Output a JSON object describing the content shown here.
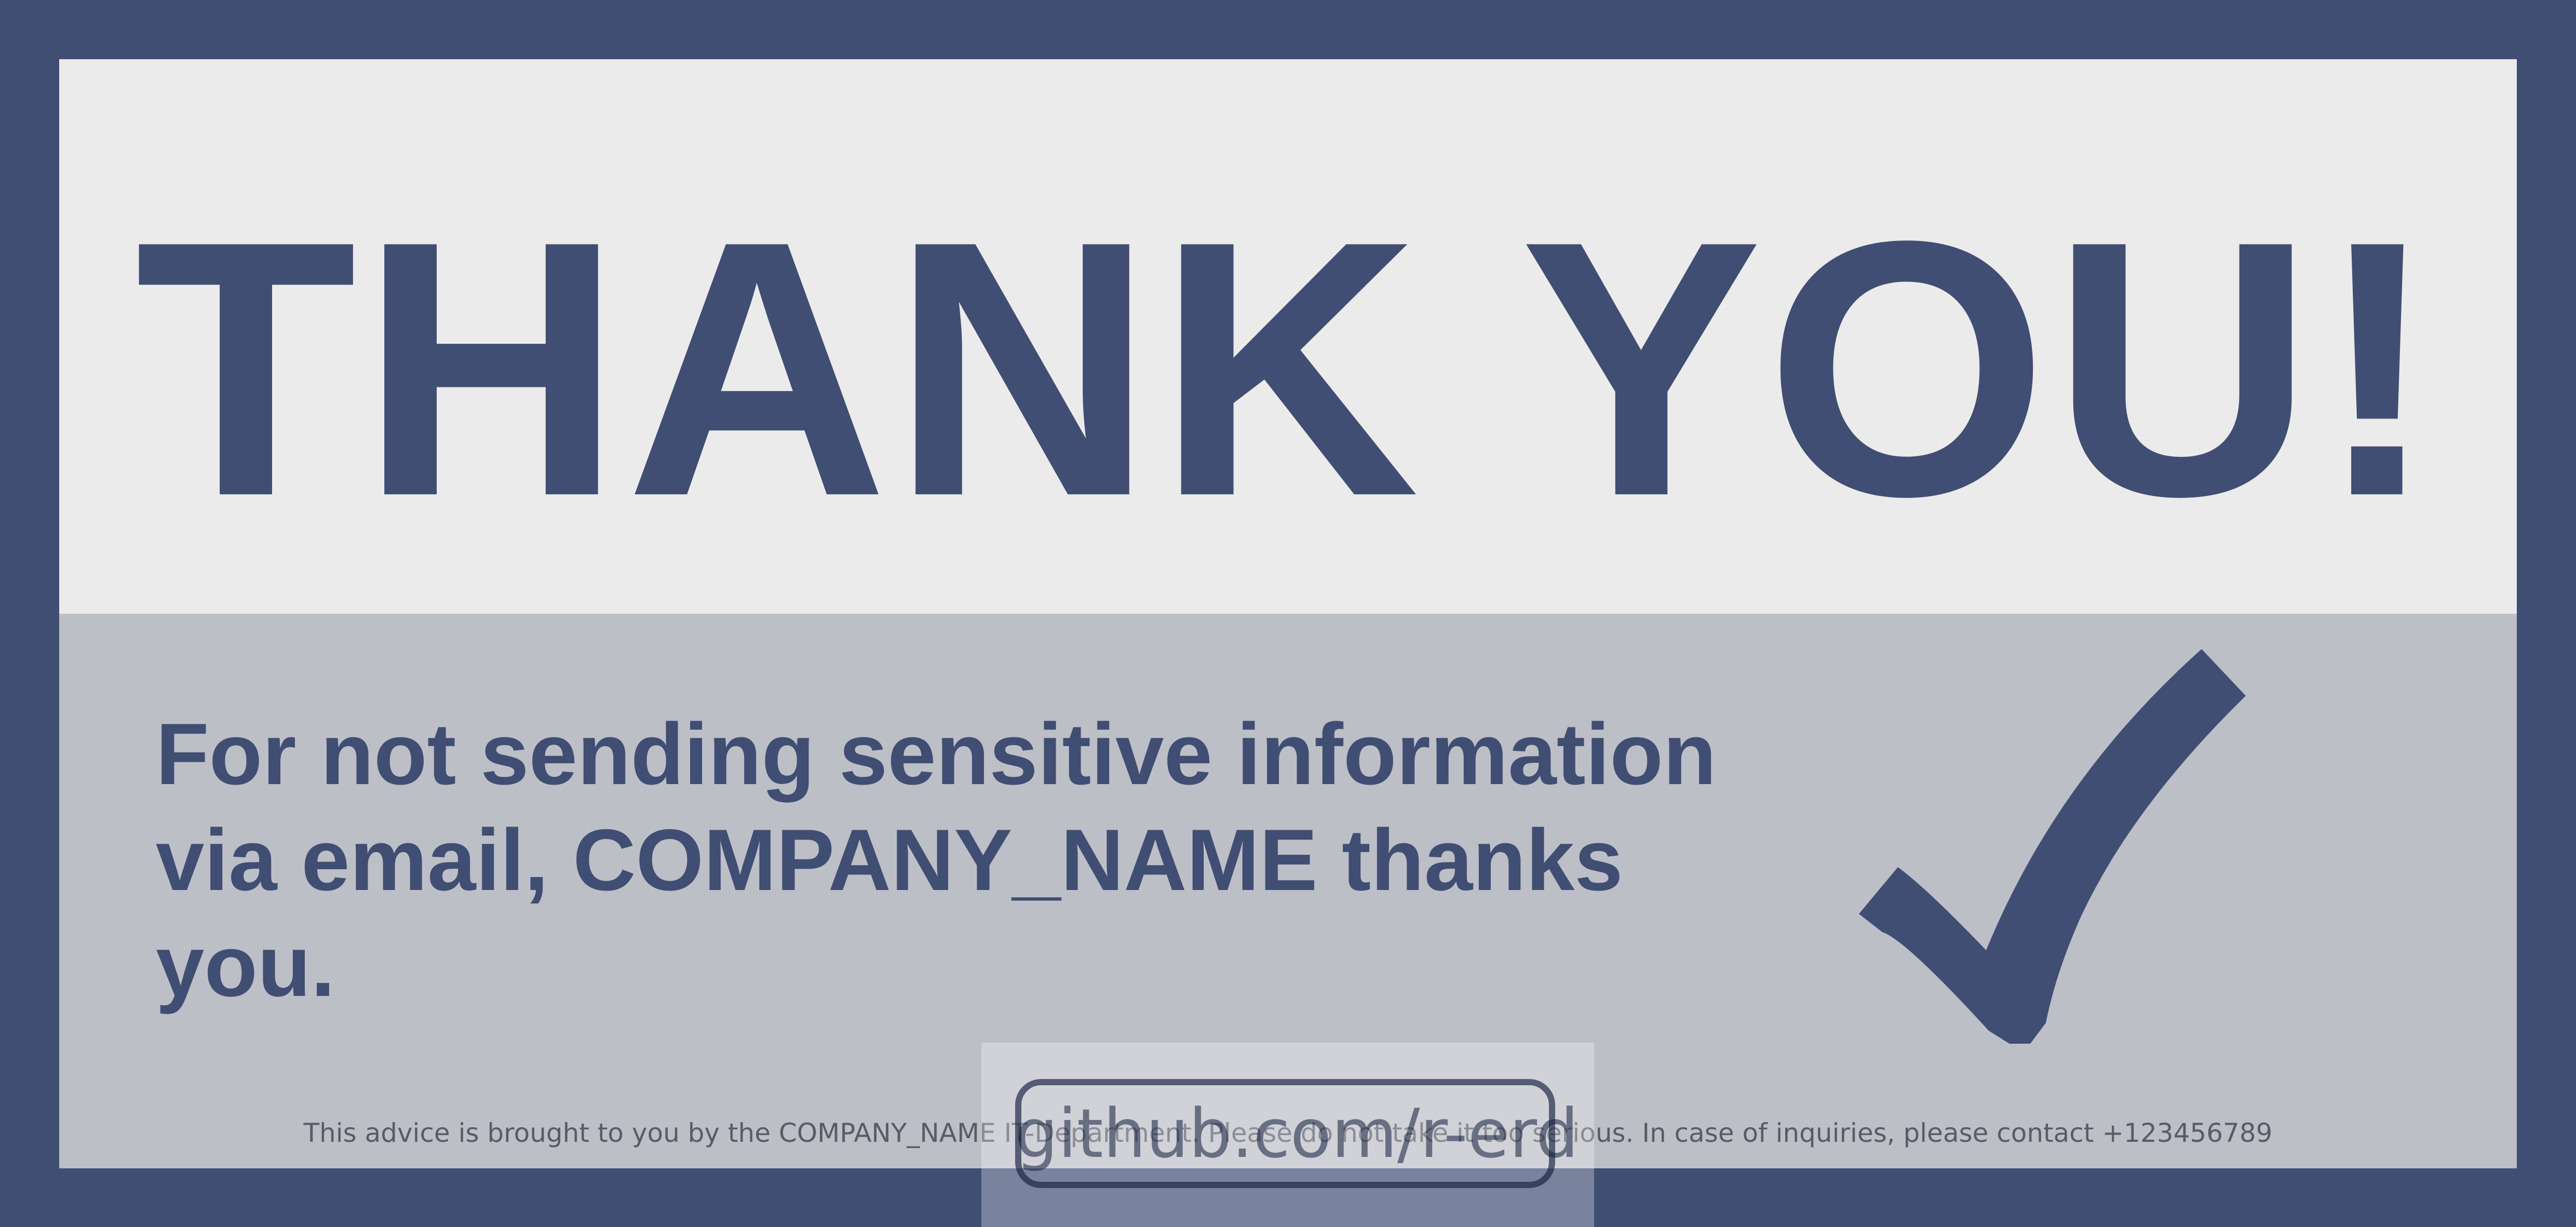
{
  "colors": {
    "frame": "#414e73",
    "top_panel": "#ebebeb",
    "bottom_panel": "#bdbfc7",
    "text": "#414e73"
  },
  "headline": "THANK YOU!",
  "message": "For not sending sensitive information via email, COMPANY_NAME thanks you.",
  "checkmark_icon": "checkmark-icon",
  "footer_note": "This advice is brought to you by the COMPANY_NAME IT-Department. Please do not take it too serious. In case of inquiries, please contact +123456789",
  "watermark": "github.com/r-erd"
}
